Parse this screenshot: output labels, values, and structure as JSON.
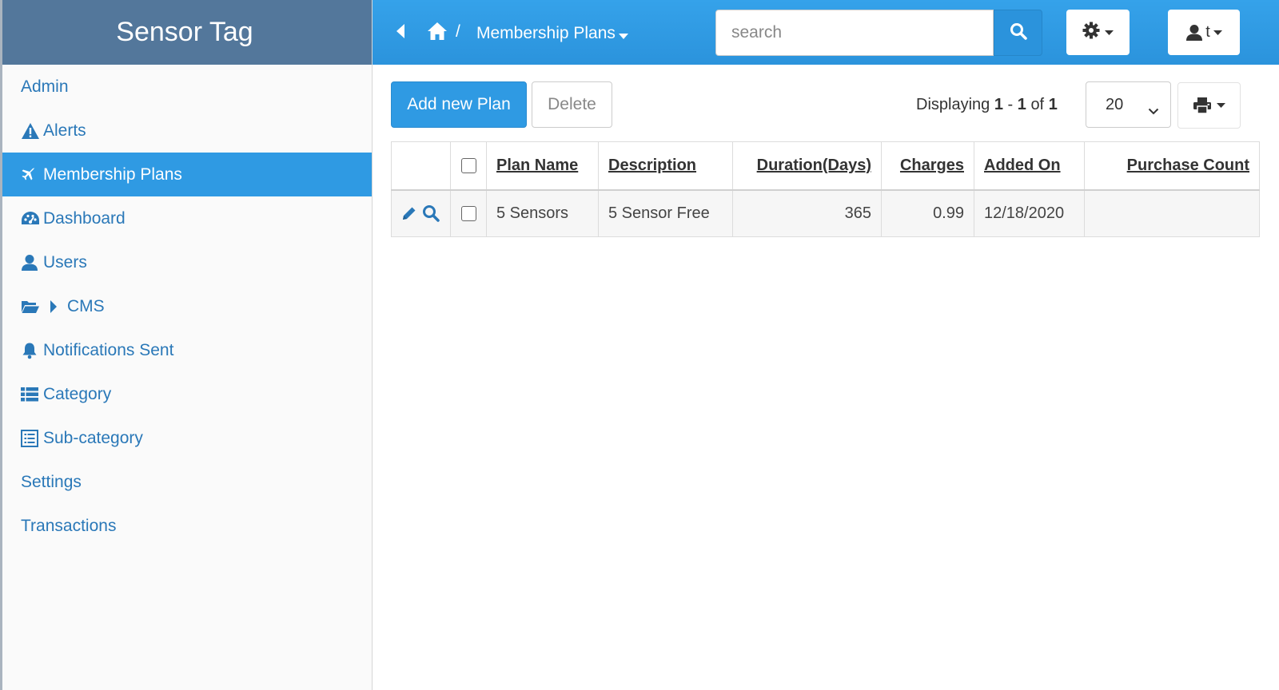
{
  "app": {
    "title": "Sensor Tag"
  },
  "sidebar": {
    "items": [
      {
        "label": "Admin",
        "icon": "none"
      },
      {
        "label": "Alerts",
        "icon": "warning-icon"
      },
      {
        "label": "Membership Plans",
        "icon": "plane-icon",
        "active": true
      },
      {
        "label": "Dashboard",
        "icon": "dashboard-icon"
      },
      {
        "label": "Users",
        "icon": "user-icon"
      },
      {
        "label": "CMS",
        "icon": "folder-open-icon"
      },
      {
        "label": "Notifications Sent",
        "icon": "bell-icon"
      },
      {
        "label": "Category",
        "icon": "list-icon"
      },
      {
        "label": "Sub-category",
        "icon": "list-alt-icon"
      },
      {
        "label": "Settings",
        "icon": "none"
      },
      {
        "label": "Transactions",
        "icon": "none"
      }
    ]
  },
  "header": {
    "breadcrumb_sep": "/",
    "breadcrumb_current": "Membership Plans",
    "search_placeholder": "search",
    "user_label": "t"
  },
  "toolbar": {
    "add_label": "Add new Plan",
    "delete_label": "Delete",
    "displaying_prefix": "Displaying",
    "range_start": "1",
    "range_sep": "-",
    "range_end": "1",
    "of_word": "of",
    "total": "1",
    "page_size": "20"
  },
  "table": {
    "columns": [
      "Plan Name",
      "Description",
      "Duration(Days)",
      "Charges",
      "Added On",
      "Purchase Count"
    ],
    "rows": [
      [
        "5 Sensors",
        "5 Sensor Free",
        "365",
        "0.99",
        "12/18/2020",
        ""
      ]
    ]
  },
  "colors": {
    "brand": "#53779b",
    "accent": "#2f9ae3",
    "link": "#2a78b8"
  }
}
